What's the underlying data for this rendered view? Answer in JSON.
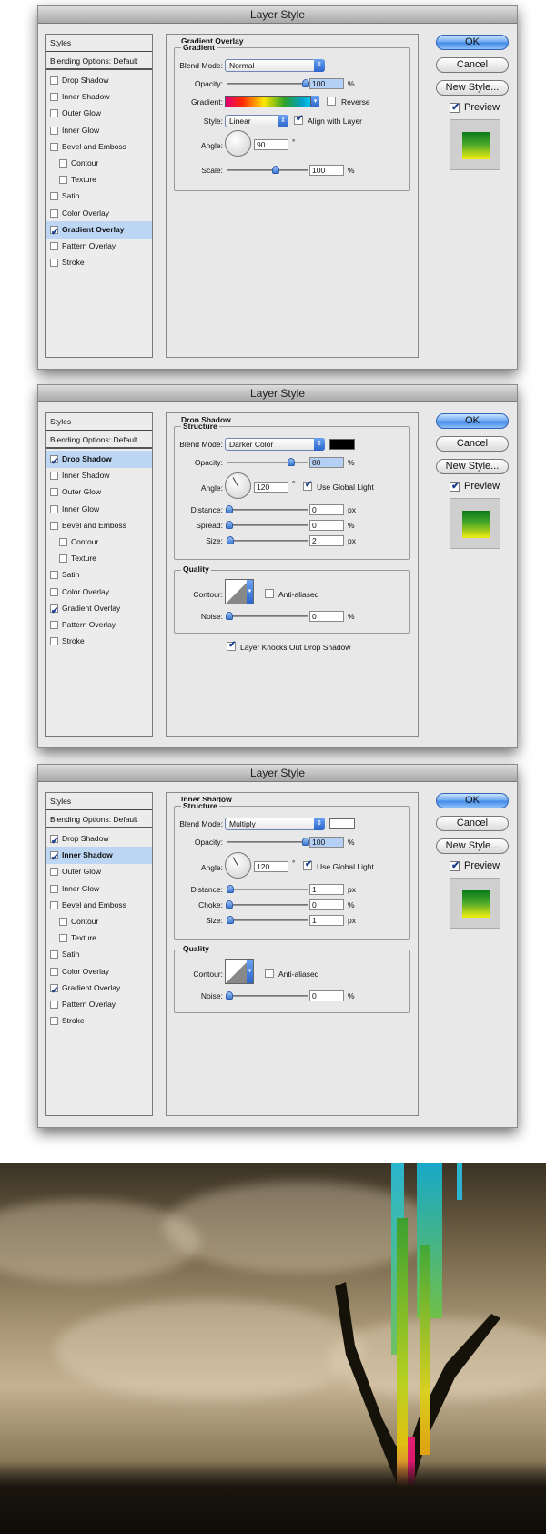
{
  "dialogs": [
    {
      "title": "Layer Style",
      "sidebar": {
        "header": "Styles",
        "blending": "Blending Options: Default",
        "items": [
          {
            "label": "Drop Shadow",
            "checked": false,
            "selected": false,
            "indent": false
          },
          {
            "label": "Inner Shadow",
            "checked": false,
            "selected": false,
            "indent": false
          },
          {
            "label": "Outer Glow",
            "checked": false,
            "selected": false,
            "indent": false
          },
          {
            "label": "Inner Glow",
            "checked": false,
            "selected": false,
            "indent": false
          },
          {
            "label": "Bevel and Emboss",
            "checked": false,
            "selected": false,
            "indent": false
          },
          {
            "label": "Contour",
            "checked": false,
            "selected": false,
            "indent": true
          },
          {
            "label": "Texture",
            "checked": false,
            "selected": false,
            "indent": true
          },
          {
            "label": "Satin",
            "checked": false,
            "selected": false,
            "indent": false
          },
          {
            "label": "Color Overlay",
            "checked": false,
            "selected": false,
            "indent": false
          },
          {
            "label": "Gradient Overlay",
            "checked": true,
            "selected": true,
            "indent": false
          },
          {
            "label": "Pattern Overlay",
            "checked": false,
            "selected": false,
            "indent": false
          },
          {
            "label": "Stroke",
            "checked": false,
            "selected": false,
            "indent": false
          }
        ]
      },
      "panel": {
        "title": "Gradient Overlay",
        "group1": "Gradient",
        "blend_mode_label": "Blend Mode:",
        "blend_mode": "Normal",
        "opacity_label": "Opacity:",
        "opacity": "100",
        "opacity_unit": "%",
        "gradient_label": "Gradient:",
        "reverse_label": "Reverse",
        "style_label": "Style:",
        "style": "Linear",
        "align_label": "Align with Layer",
        "angle_label": "Angle:",
        "angle": "90",
        "angle_unit": "°",
        "scale_label": "Scale:",
        "scale": "100",
        "scale_unit": "%"
      }
    },
    {
      "title": "Layer Style",
      "sidebar": {
        "header": "Styles",
        "blending": "Blending Options: Default",
        "items": [
          {
            "label": "Drop Shadow",
            "checked": true,
            "selected": true,
            "indent": false
          },
          {
            "label": "Inner Shadow",
            "checked": false,
            "selected": false,
            "indent": false
          },
          {
            "label": "Outer Glow",
            "checked": false,
            "selected": false,
            "indent": false
          },
          {
            "label": "Inner Glow",
            "checked": false,
            "selected": false,
            "indent": false
          },
          {
            "label": "Bevel and Emboss",
            "checked": false,
            "selected": false,
            "indent": false
          },
          {
            "label": "Contour",
            "checked": false,
            "selected": false,
            "indent": true
          },
          {
            "label": "Texture",
            "checked": false,
            "selected": false,
            "indent": true
          },
          {
            "label": "Satin",
            "checked": false,
            "selected": false,
            "indent": false
          },
          {
            "label": "Color Overlay",
            "checked": false,
            "selected": false,
            "indent": false
          },
          {
            "label": "Gradient Overlay",
            "checked": true,
            "selected": false,
            "indent": false
          },
          {
            "label": "Pattern Overlay",
            "checked": false,
            "selected": false,
            "indent": false
          },
          {
            "label": "Stroke",
            "checked": false,
            "selected": false,
            "indent": false
          }
        ]
      },
      "panel": {
        "title": "Drop Shadow",
        "group1": "Structure",
        "blend_mode_label": "Blend Mode:",
        "blend_mode": "Darker Color",
        "opacity_label": "Opacity:",
        "opacity": "80",
        "angle_label": "Angle:",
        "angle": "120",
        "global_light_label": "Use Global Light",
        "distance_label": "Distance:",
        "distance": "0",
        "spread_label": "Spread:",
        "spread": "0",
        "size_label": "Size:",
        "size": "2",
        "group2": "Quality",
        "contour_label": "Contour:",
        "anti_aliased_label": "Anti-aliased",
        "noise_label": "Noise:",
        "noise": "0",
        "knockout_label": "Layer Knocks Out Drop Shadow",
        "unit_pct": "%",
        "unit_px": "px",
        "unit_deg": "°",
        "swatch_color": "#000000"
      }
    },
    {
      "title": "Layer Style",
      "sidebar": {
        "header": "Styles",
        "blending": "Blending Options: Default",
        "items": [
          {
            "label": "Drop Shadow",
            "checked": true,
            "selected": false,
            "indent": false
          },
          {
            "label": "Inner Shadow",
            "checked": true,
            "selected": true,
            "indent": false
          },
          {
            "label": "Outer Glow",
            "checked": false,
            "selected": false,
            "indent": false
          },
          {
            "label": "Inner Glow",
            "checked": false,
            "selected": false,
            "indent": false
          },
          {
            "label": "Bevel and Emboss",
            "checked": false,
            "selected": false,
            "indent": false
          },
          {
            "label": "Contour",
            "checked": false,
            "selected": false,
            "indent": true
          },
          {
            "label": "Texture",
            "checked": false,
            "selected": false,
            "indent": true
          },
          {
            "label": "Satin",
            "checked": false,
            "selected": false,
            "indent": false
          },
          {
            "label": "Color Overlay",
            "checked": false,
            "selected": false,
            "indent": false
          },
          {
            "label": "Gradient Overlay",
            "checked": true,
            "selected": false,
            "indent": false
          },
          {
            "label": "Pattern Overlay",
            "checked": false,
            "selected": false,
            "indent": false
          },
          {
            "label": "Stroke",
            "checked": false,
            "selected": false,
            "indent": false
          }
        ]
      },
      "panel": {
        "title": "Inner Shadow",
        "group1": "Structure",
        "blend_mode_label": "Blend Mode:",
        "blend_mode": "Multiply",
        "opacity_label": "Opacity:",
        "opacity": "100",
        "angle_label": "Angle:",
        "angle": "120",
        "global_light_label": "Use Global Light",
        "distance_label": "Distance:",
        "distance": "1",
        "spread_label": "Choke:",
        "spread": "0",
        "size_label": "Size:",
        "size": "1",
        "group2": "Quality",
        "contour_label": "Contour:",
        "anti_aliased_label": "Anti-aliased",
        "noise_label": "Noise:",
        "noise": "0",
        "unit_pct": "%",
        "unit_px": "px",
        "unit_deg": "°",
        "swatch_color": "#ffffff"
      }
    }
  ],
  "buttons": {
    "ok": "OK",
    "cancel": "Cancel",
    "new_style": "New Style...",
    "preview": "Preview"
  },
  "colors": {
    "selection": "#bcd6f4",
    "accent": "#3f87e6"
  }
}
